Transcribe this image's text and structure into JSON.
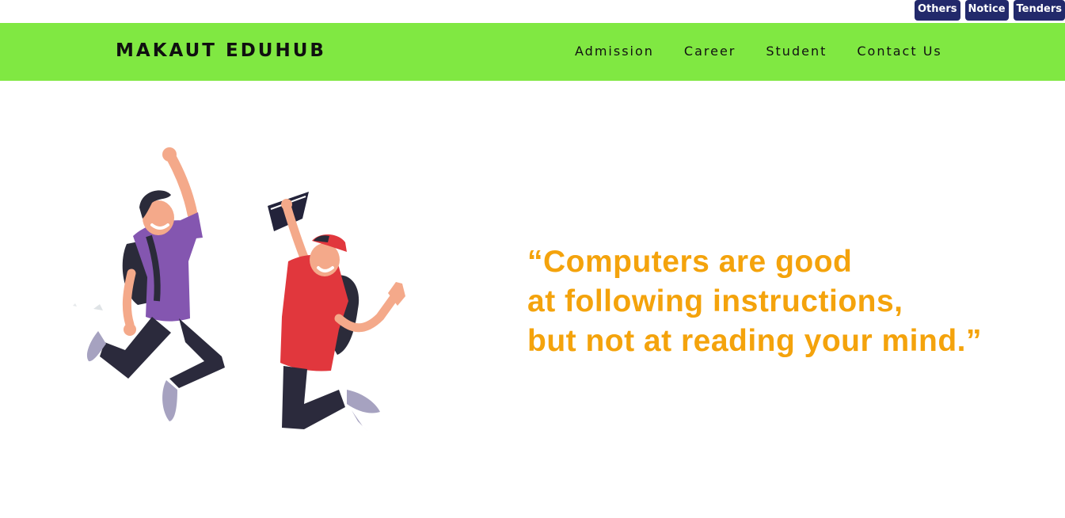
{
  "top_links": [
    "Others",
    "Notice",
    "Tenders"
  ],
  "header": {
    "brand": "MAKAUT EDUHUB",
    "nav": [
      "Admission",
      "Career",
      "Student",
      "Contact Us"
    ]
  },
  "hero": {
    "illustration": "two-students-jumping",
    "quote_lines": [
      "“Computers are good",
      "at following instructions,",
      "but not at reading your mind.”"
    ]
  },
  "colors": {
    "navbar": "#80e842",
    "quick_link_bg": "#22296b",
    "quote": "#f4a30c"
  }
}
